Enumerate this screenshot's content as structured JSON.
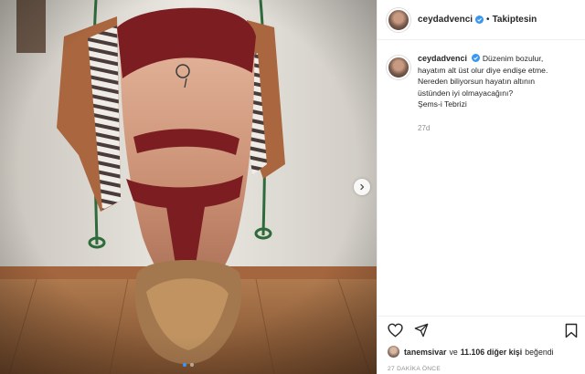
{
  "post": {
    "author": {
      "username": "ceydadvenci",
      "verified": true,
      "follow_status": "Takiptesin",
      "separator": "•"
    },
    "caption": {
      "lines": [
        "Düzenim bozulur,",
        "hayatım alt üst olur diye endişe etme.",
        "Nereden biliyorsun hayatın altının",
        "üstünden iyi olmayacağını?",
        "Şems-i Tebrizi"
      ],
      "age": "27d"
    },
    "media": {
      "carousel_dots": 2,
      "active_dot": 0,
      "icons": [
        "chevron-right-icon"
      ]
    },
    "likes": {
      "first_liker": "tanemsivar",
      "connector": "ve",
      "others_count": "11.106 diğer kişi",
      "suffix": "beğendi"
    },
    "timestamp": "27 DAKİKA ÖNCE",
    "icons": [
      "heart-icon",
      "share-icon",
      "bookmark-icon",
      "verified-icon"
    ],
    "colors": {
      "verified": "#3897f0",
      "muted": "#8e8e8e",
      "text": "#262626"
    }
  }
}
